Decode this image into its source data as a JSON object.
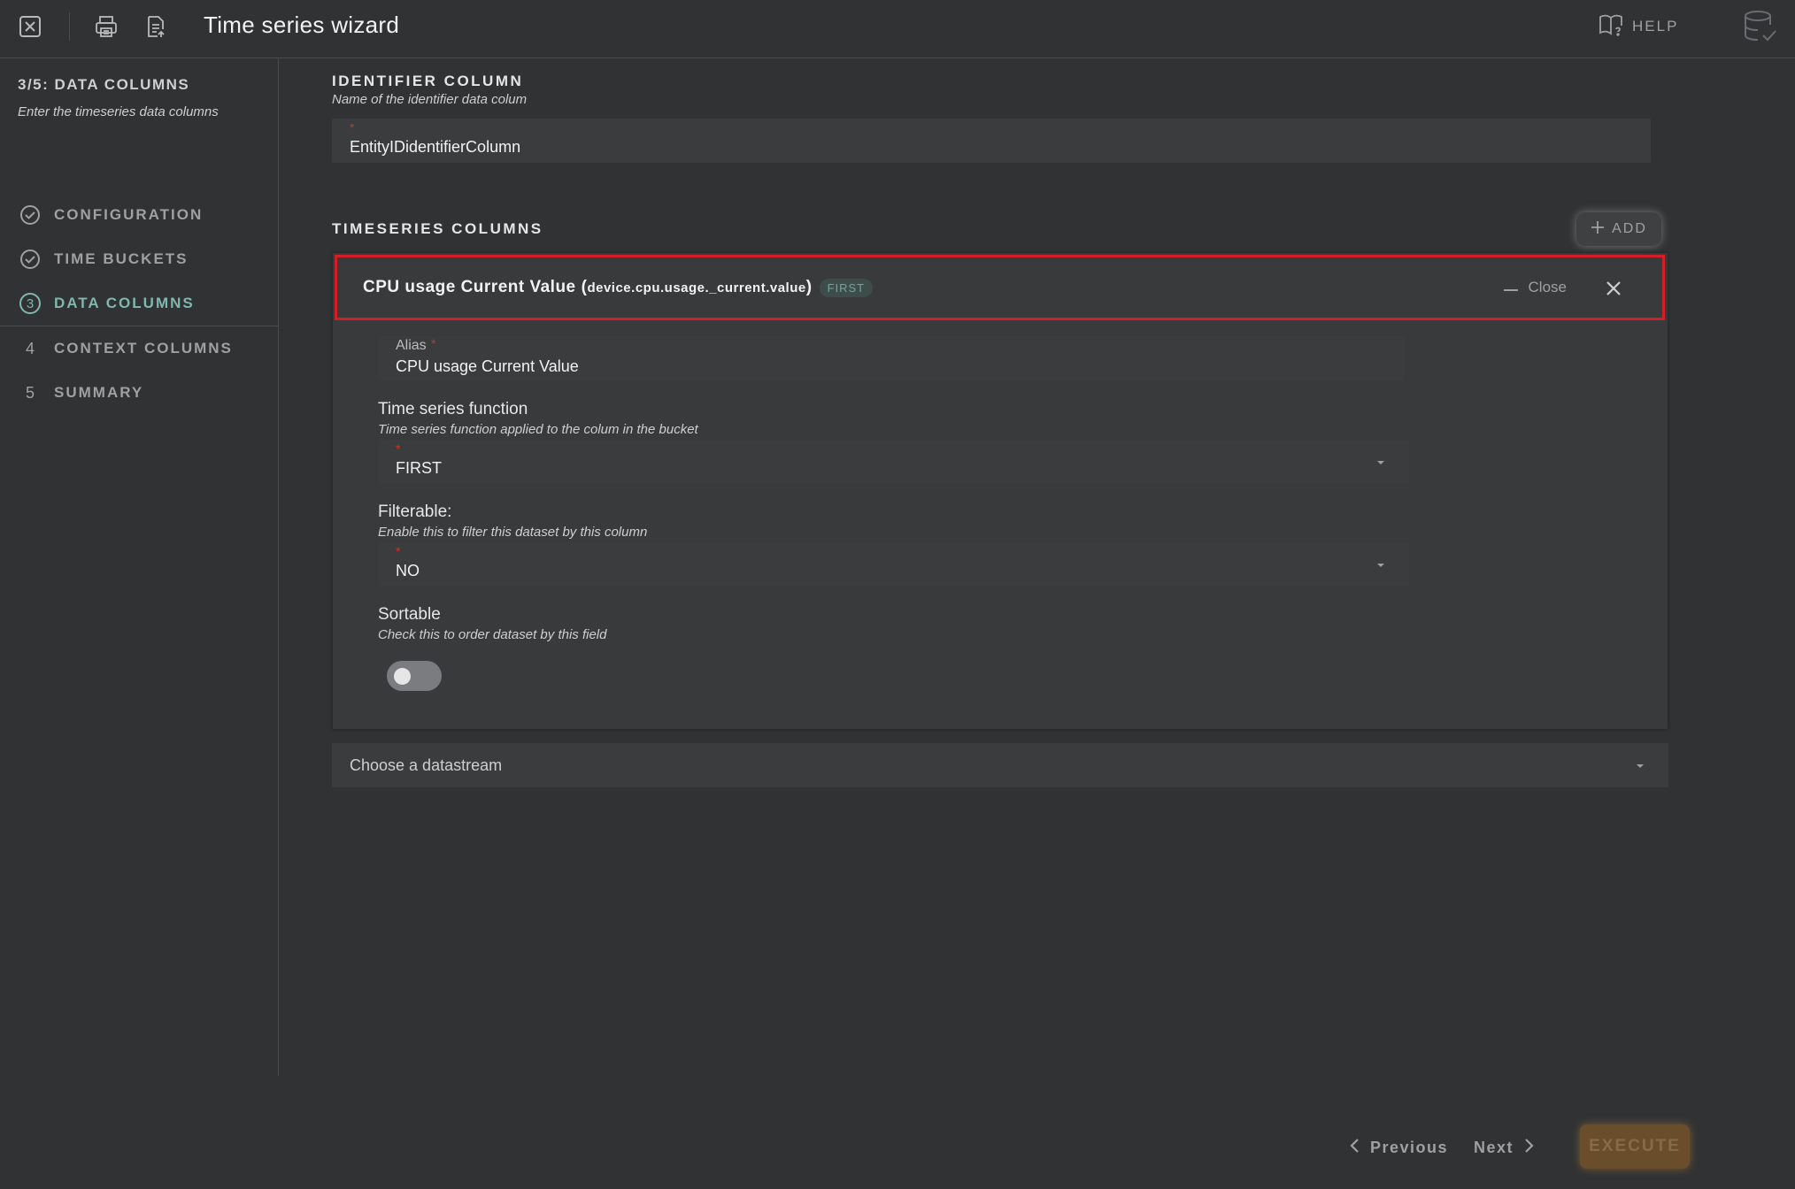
{
  "topbar": {
    "title": "Time series wizard",
    "help_label": "HELP",
    "icons": [
      "close-icon",
      "print-icon",
      "export-icon",
      "help-book-icon",
      "user-database-icon"
    ]
  },
  "sidebar": {
    "step_heading": "3/5: DATA COLUMNS",
    "step_description": "Enter the timeseries data columns",
    "steps": [
      {
        "marker": "✓",
        "label": "CONFIGURATION",
        "state": "done"
      },
      {
        "marker": "✓",
        "label": "TIME BUCKETS",
        "state": "done"
      },
      {
        "marker": "3",
        "label": "DATA COLUMNS",
        "state": "active"
      },
      {
        "marker": "4",
        "label": "CONTEXT COLUMNS",
        "state": "pending"
      },
      {
        "marker": "5",
        "label": "SUMMARY",
        "state": "pending"
      }
    ]
  },
  "identifier": {
    "title": "IDENTIFIER COLUMN",
    "description": "Name of the identifier data colum",
    "required_mark": "*",
    "value": "EntityIDidentifierColumn"
  },
  "timeseries": {
    "title": "TIMESERIES COLUMNS",
    "add_label": "ADD",
    "column": {
      "name": "CPU usage Current Value",
      "path": "device.cpu.usage._current.value",
      "open_paren": "(",
      "close_paren": ")",
      "badge": "FIRST",
      "close_label": "Close",
      "alias": {
        "label": "Alias",
        "required_mark": "*",
        "value": "CPU usage Current Value"
      },
      "function": {
        "title": "Time series function",
        "description": "Time series function applied to the colum in the bucket",
        "required_mark": "*",
        "value": "FIRST"
      },
      "filterable": {
        "title": "Filterable:",
        "description": "Enable this to filter this dataset by this column",
        "required_mark": "*",
        "value": "NO"
      },
      "sortable": {
        "title": "Sortable",
        "description": "Check this to order dataset by this field",
        "enabled": false
      }
    },
    "datastream_placeholder": "Choose a datastream"
  },
  "footer": {
    "previous_label": "Previous",
    "next_label": "Next",
    "execute_label": "EXECUTE"
  },
  "colors": {
    "background": "#313234",
    "accent": "#7fb8ae",
    "highlight_border": "#d51d26",
    "execute": "#6a4e2c"
  }
}
